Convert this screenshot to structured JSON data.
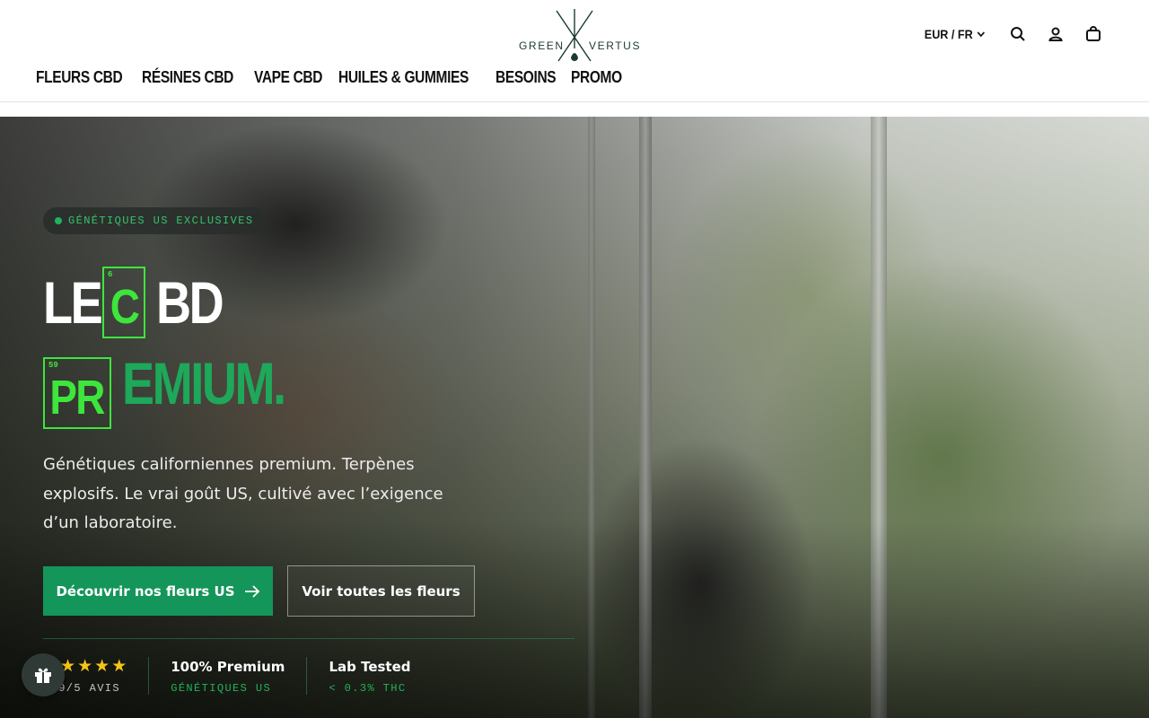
{
  "brand": {
    "left": "GREEN",
    "right": "VERTUS"
  },
  "nav": [
    {
      "label": "FLEURS CBD"
    },
    {
      "label": "RÉSINES CBD"
    },
    {
      "label": "VAPE CBD"
    },
    {
      "label": "HUILES & GUMMIES"
    },
    {
      "label": "BESOINS"
    },
    {
      "label": "PROMO"
    }
  ],
  "header": {
    "locale": "EUR / FR",
    "icons": [
      "search-icon",
      "account-icon",
      "cart-icon"
    ]
  },
  "hero": {
    "badge": "GÉNÉTIQUES US EXCLUSIVES",
    "line1_prefix": "LE",
    "element1": {
      "number": "6",
      "symbol": "C"
    },
    "line1_suffix": "BD",
    "element2": {
      "number": "59",
      "symbol": "PR"
    },
    "line2_suffix": "EMIUM.",
    "description": "Génétiques californiennes premium. Terpènes explosifs. Le vrai goût US, cultivé avec l’exigence d’un laboratoire.",
    "primary_cta": "Découvrir nos fleurs US",
    "secondary_cta": "Voir toutes les fleurs"
  },
  "stats": [
    {
      "type": "rating",
      "stars": 5,
      "sub": "4.9/5 AVIS"
    },
    {
      "title": "100% Premium",
      "sub": "GÉNÉTIQUES US"
    },
    {
      "title": "Lab Tested",
      "sub": "< 0.3% THC"
    }
  ],
  "colors": {
    "accent": "#14955a",
    "element_green": "#3ce63c",
    "star": "#f5c518"
  }
}
